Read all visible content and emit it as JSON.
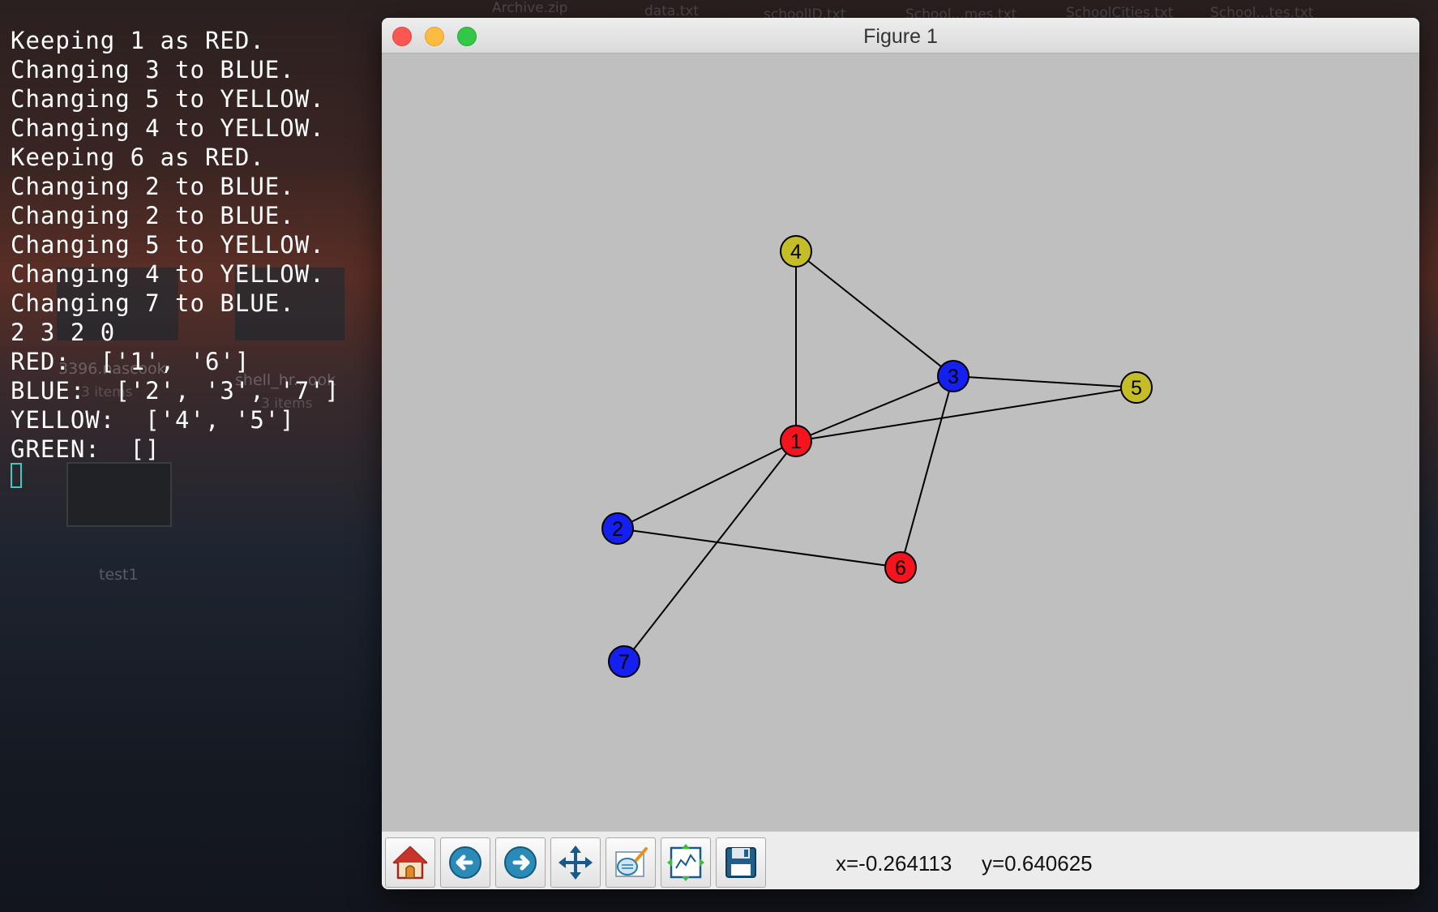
{
  "desktop": {
    "icon_labels": [
      "Archive.zip",
      "data.txt",
      "schoolID.txt",
      "School...mes.txt",
      "SchoolCities.txt",
      "School...tes.txt"
    ],
    "left_labels": [
      "3396.nascook",
      "3 items",
      "shell_hr...ook",
      "3 items",
      "test1"
    ]
  },
  "terminal": {
    "lines": [
      "Keeping 1 as RED.",
      "Changing 3 to BLUE.",
      "Changing 5 to YELLOW.",
      "Changing 4 to YELLOW.",
      "Keeping 6 as RED.",
      "Changing 2 to BLUE.",
      "Changing 2 to BLUE.",
      "Changing 5 to YELLOW.",
      "Changing 4 to YELLOW.",
      "Changing 7 to BLUE.",
      "2 3 2 0",
      "RED:  ['1', '6']",
      "BLUE:  ['2', '3', '7']",
      "YELLOW:  ['4', '5']",
      "GREEN:  []"
    ]
  },
  "window": {
    "title": "Figure 1"
  },
  "colors": {
    "red": "#f5141e",
    "blue": "#1420ef",
    "yellow": "#c4bd28",
    "canvas": "#bfbfbf"
  },
  "graph": {
    "nodes": [
      {
        "id": "1",
        "color": "red"
      },
      {
        "id": "2",
        "color": "blue"
      },
      {
        "id": "3",
        "color": "blue"
      },
      {
        "id": "4",
        "color": "yellow"
      },
      {
        "id": "5",
        "color": "yellow"
      },
      {
        "id": "6",
        "color": "red"
      },
      {
        "id": "7",
        "color": "blue"
      }
    ],
    "edges": [
      [
        "1",
        "4"
      ],
      [
        "1",
        "3"
      ],
      [
        "1",
        "5"
      ],
      [
        "1",
        "2"
      ],
      [
        "1",
        "7"
      ],
      [
        "4",
        "3"
      ],
      [
        "3",
        "5"
      ],
      [
        "3",
        "6"
      ],
      [
        "2",
        "6"
      ]
    ]
  },
  "toolbar": {
    "buttons": [
      {
        "icon": "home-icon"
      },
      {
        "icon": "back-icon"
      },
      {
        "icon": "forward-icon"
      },
      {
        "icon": "pan-icon"
      },
      {
        "icon": "zoom-icon"
      },
      {
        "icon": "subplots-icon"
      },
      {
        "icon": "save-icon"
      }
    ],
    "x_readout": "x=-0.264113",
    "y_readout": "y=0.640625"
  }
}
